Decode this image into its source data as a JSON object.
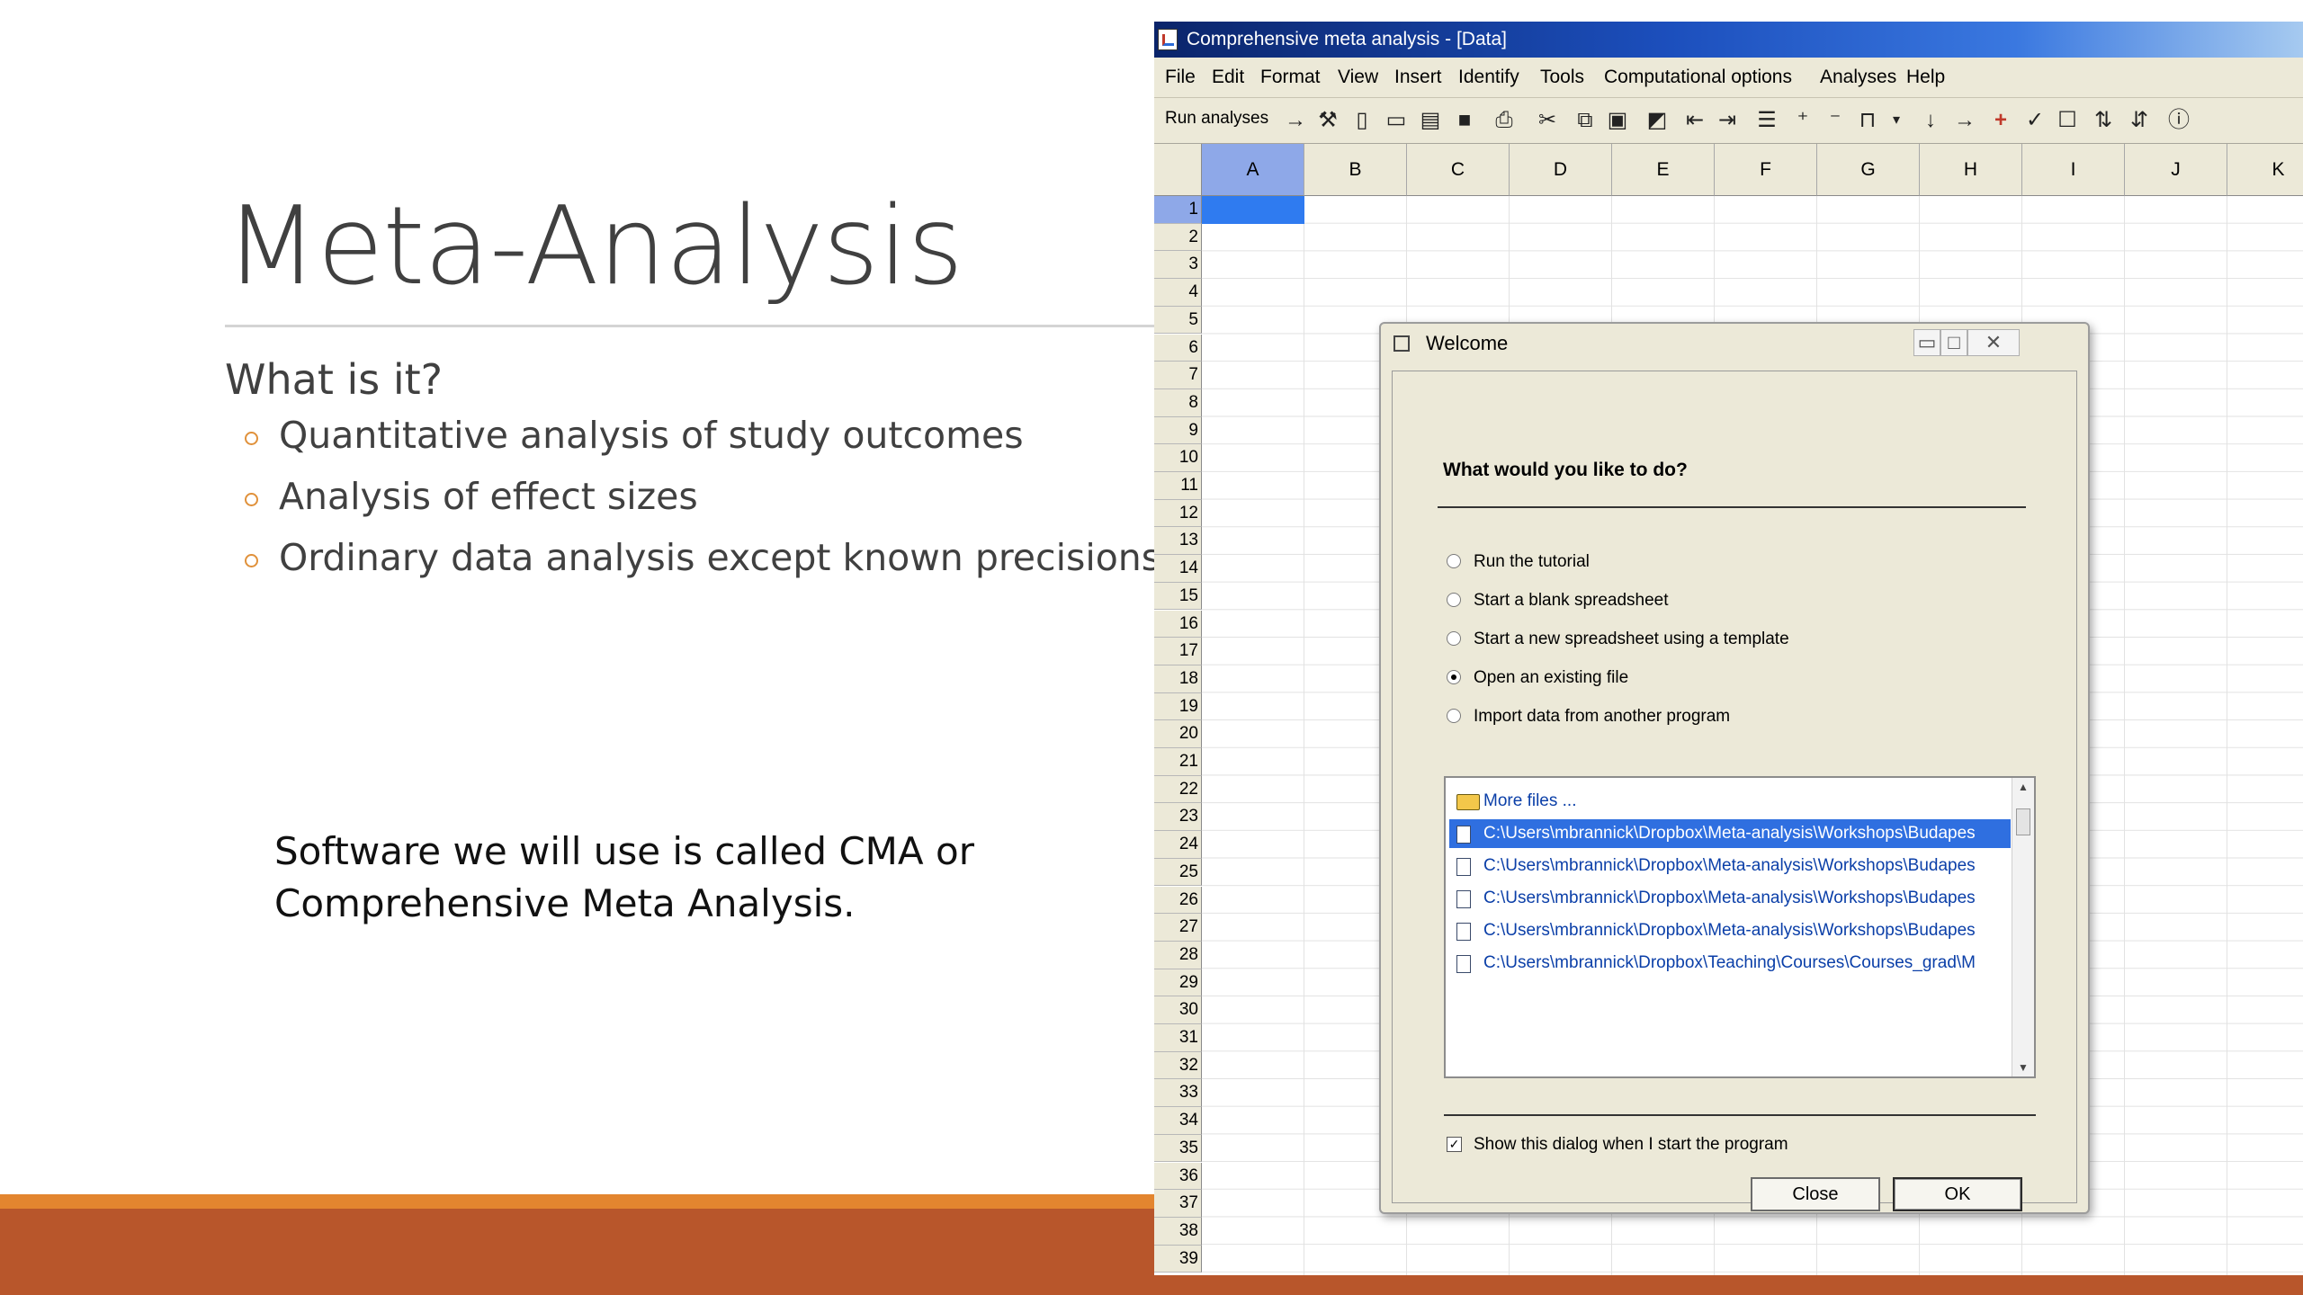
{
  "slide": {
    "title": "Meta-Analysis",
    "subheading": "What is it?",
    "bullets": [
      "Quantitative analysis of study outcomes",
      "Analysis of effect sizes",
      "Ordinary data analysis except known precisions"
    ],
    "note": "Software we will use is called CMA or Comprehensive Meta Analysis."
  },
  "app": {
    "window_title": "Comprehensive meta analysis - [Data]",
    "menu": [
      "File",
      "Edit",
      "Format",
      "View",
      "Insert",
      "Identify",
      "Tools",
      "Computational options",
      "Analyses",
      "Help"
    ],
    "toolbar": {
      "run_label": "Run analyses",
      "icons": [
        "arrow-right-icon",
        "wand-icon",
        "new-file-icon",
        "open-folder-icon",
        "template-icon",
        "save-icon",
        "print-icon",
        "cut-icon",
        "copy-icon",
        "paste-icon",
        "import-icon",
        "outdent-icon",
        "indent-icon",
        "list-icon",
        "decimal-increase-icon",
        "decimal-decrease-icon",
        "column-format-icon",
        "dropdown-icon",
        "arrow-down-icon",
        "arrow-right-icon",
        "plus-icon",
        "check-icon",
        "blank-icon",
        "sort-ascending-icon",
        "sort-descending-icon",
        "info-icon"
      ]
    },
    "columns": [
      "A",
      "B",
      "C",
      "D",
      "E",
      "F",
      "G",
      "H",
      "I",
      "J",
      "K"
    ],
    "selected_column": "A",
    "rows": [
      "1",
      "2",
      "3",
      "4",
      "5",
      "6",
      "7",
      "8",
      "9",
      "10",
      "11",
      "12",
      "13",
      "14",
      "15",
      "16",
      "17",
      "18",
      "19",
      "20",
      "21",
      "22",
      "23",
      "24",
      "25",
      "26",
      "27",
      "28",
      "29",
      "30",
      "31",
      "32",
      "33",
      "34",
      "35",
      "36",
      "37",
      "38",
      "39"
    ],
    "selected_row": "1"
  },
  "dialog": {
    "title": "Welcome",
    "question": "What would you like to do?",
    "options": [
      {
        "label": "Run the tutorial",
        "selected": false
      },
      {
        "label": "Start a blank spreadsheet",
        "selected": false
      },
      {
        "label": "Start a new spreadsheet using a template",
        "selected": false
      },
      {
        "label": "Open an existing file",
        "selected": true
      },
      {
        "label": "Import data from another program",
        "selected": false
      }
    ],
    "files": [
      {
        "label": "More files ...",
        "type": "folder"
      },
      {
        "label": "C:\\Users\\mbrannick\\Dropbox\\Meta-analysis\\Workshops\\Budapes",
        "type": "file",
        "selected": true
      },
      {
        "label": "C:\\Users\\mbrannick\\Dropbox\\Meta-analysis\\Workshops\\Budapes",
        "type": "file"
      },
      {
        "label": "C:\\Users\\mbrannick\\Dropbox\\Meta-analysis\\Workshops\\Budapes",
        "type": "file"
      },
      {
        "label": "C:\\Users\\mbrannick\\Dropbox\\Meta-analysis\\Workshops\\Budapes",
        "type": "file"
      },
      {
        "label": "C:\\Users\\mbrannick\\Dropbox\\Teaching\\Courses\\Courses_grad\\M",
        "type": "file"
      }
    ],
    "show_on_start_label": "Show this dialog when I start the program",
    "show_on_start_checked": true,
    "close_label": "Close",
    "ok_label": "OK"
  },
  "colors": {
    "accent_orange": "#e3852f",
    "footer_bar": "#b8562b",
    "selection_blue": "#2f6fe0"
  }
}
